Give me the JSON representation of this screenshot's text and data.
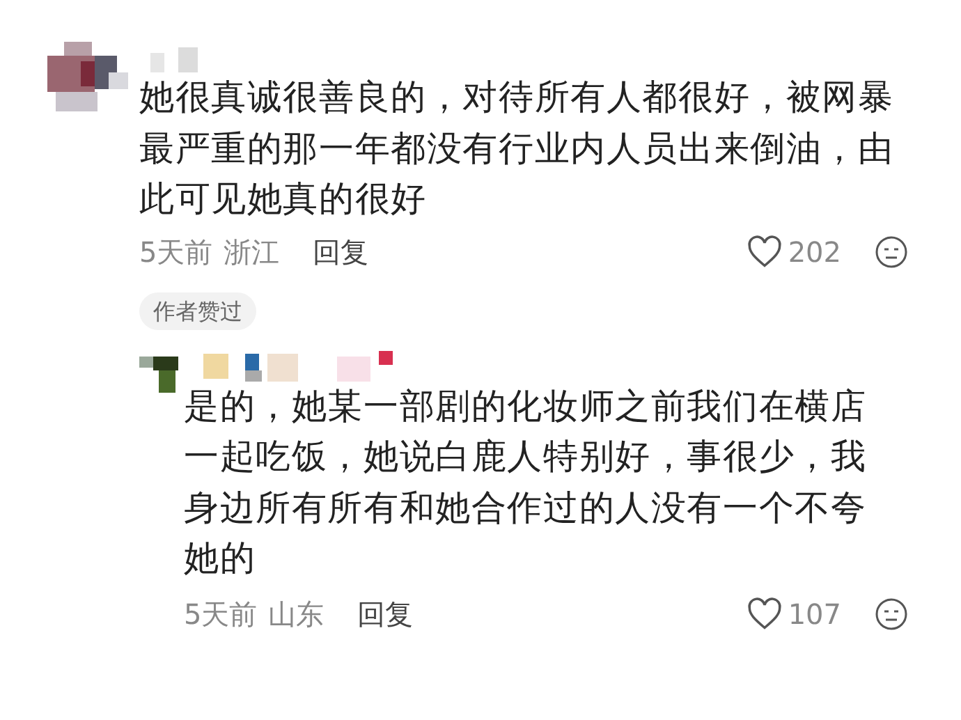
{
  "comments": [
    {
      "text": "她很真诚很善良的，对待所有人都很好，被网暴最严重的那一年都没有行业内人员出来倒油，由此可见她真的很好",
      "time": "5天前",
      "location": "浙江",
      "reply_label": "回复",
      "likes": "202",
      "liked": false,
      "tag": "作者赞过",
      "replies": [
        {
          "text": "是的，她某一部剧的化妆师之前我们在横店一起吃饭，她说白鹿人特别好，事很少，我身边所有所有和她合作过的人没有一个不夸她的",
          "time": "5天前",
          "location": "山东",
          "reply_label": "回复",
          "likes": "107",
          "liked": false
        }
      ]
    }
  ]
}
